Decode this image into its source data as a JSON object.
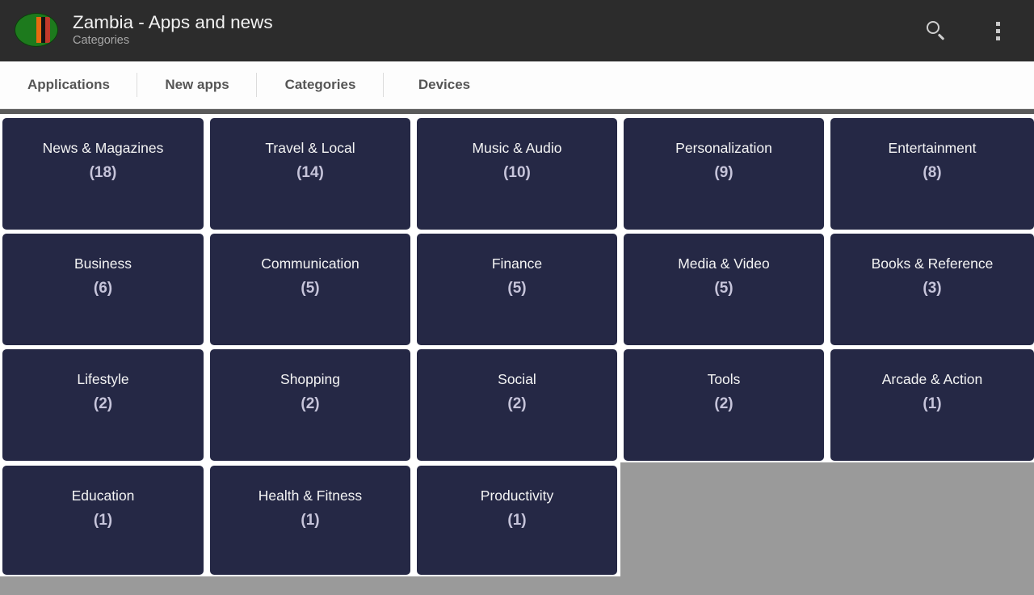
{
  "header": {
    "title": "Zambia - Apps and news",
    "subtitle": "Categories",
    "app_icon": "zambia-flag-icon",
    "search_icon": "search-icon",
    "overflow_icon": "more-vertical-icon",
    "background_color": "#2c2c2c"
  },
  "tabs": [
    {
      "label": "Applications",
      "selected": false
    },
    {
      "label": "New apps",
      "selected": false
    },
    {
      "label": "Categories",
      "selected": true
    },
    {
      "label": "Devices",
      "selected": false
    }
  ],
  "grid": {
    "card_color": "#252845",
    "title_color": "#f4f4f4",
    "count_color": "#c6c4da",
    "empty_color": "#9a9a9a",
    "columns": 5,
    "rows": 4,
    "cards": [
      {
        "label": "News & Magazines",
        "count": "(18)"
      },
      {
        "label": "Travel & Local",
        "count": "(14)"
      },
      {
        "label": "Music & Audio",
        "count": "(10)"
      },
      {
        "label": "Personalization",
        "count": "(9)"
      },
      {
        "label": "Entertainment",
        "count": "(8)"
      },
      {
        "label": "Business",
        "count": "(6)"
      },
      {
        "label": "Communication",
        "count": "(5)"
      },
      {
        "label": "Finance",
        "count": "(5)"
      },
      {
        "label": "Media & Video",
        "count": "(5)"
      },
      {
        "label": "Books & Reference",
        "count": "(3)"
      },
      {
        "label": "Lifestyle",
        "count": "(2)"
      },
      {
        "label": "Shopping",
        "count": "(2)"
      },
      {
        "label": "Social",
        "count": "(2)"
      },
      {
        "label": "Tools",
        "count": "(2)"
      },
      {
        "label": "Arcade & Action",
        "count": "(1)"
      },
      {
        "label": "Education",
        "count": "(1)"
      },
      {
        "label": "Health & Fitness",
        "count": "(1)"
      },
      {
        "label": "Productivity",
        "count": "(1)"
      }
    ]
  }
}
